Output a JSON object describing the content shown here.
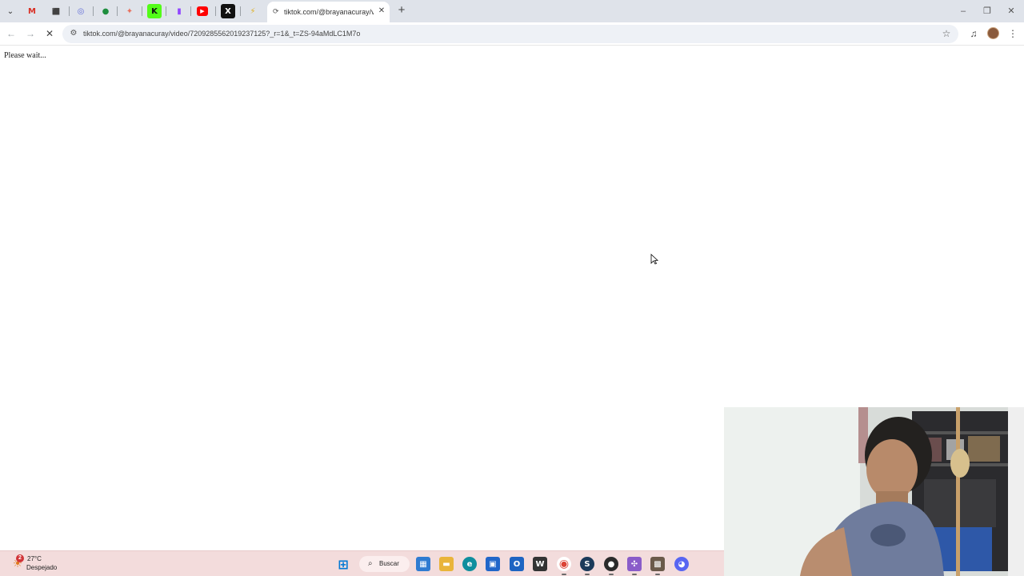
{
  "browser": {
    "active_tab": {
      "title": "tiktok.com/@brayanacuray/vid",
      "close_symbol": "✕"
    },
    "pinned_tabs": [
      {
        "name": "gmail",
        "glyph": "M",
        "color": "#d93025"
      },
      {
        "name": "extension",
        "glyph": "⬛",
        "color": "#3c4043"
      },
      {
        "name": "circle-app",
        "glyph": "◎",
        "color": "#5f6bd8"
      },
      {
        "name": "green-app",
        "glyph": "●",
        "color": "#1e8e3e"
      },
      {
        "name": "butterfly-app",
        "glyph": "✦",
        "color": "#e8715f"
      },
      {
        "name": "kick",
        "glyph": "K",
        "color": "#1a1a1a"
      },
      {
        "name": "twitch",
        "glyph": "▮",
        "color": "#9146ff"
      },
      {
        "name": "youtube",
        "glyph": "▶",
        "color": "#ff0000"
      },
      {
        "name": "x",
        "glyph": "X",
        "color": "#111111"
      },
      {
        "name": "yellow-app",
        "glyph": "⚡",
        "color": "#e0b020"
      }
    ],
    "url": "tiktok.com/@brayanacuray/video/7209285562019237125?_r=1&_t=ZS-94aMdLC1M7o",
    "reload_state": "loading"
  },
  "page": {
    "message": "Please wait..."
  },
  "taskbar": {
    "weather": {
      "temp": "27°C",
      "condition": "Despejado",
      "badge": "2"
    },
    "search_label": "Buscar",
    "apps": [
      {
        "name": "windows-start",
        "glyph": "⊞",
        "color": "#0078d4"
      },
      {
        "name": "widgets",
        "glyph": "▦",
        "color": "#2f7bd1"
      },
      {
        "name": "file-explorer",
        "glyph": "▬",
        "color": "#e9b43a"
      },
      {
        "name": "edge",
        "glyph": "e",
        "color": "#0f8e9e"
      },
      {
        "name": "store",
        "glyph": "▣",
        "color": "#2166c9"
      },
      {
        "name": "outlook",
        "glyph": "O",
        "color": "#1d64c2"
      },
      {
        "name": "app-v",
        "glyph": "W",
        "color": "#333333"
      },
      {
        "name": "chrome",
        "glyph": "◉",
        "color": "#34a853"
      },
      {
        "name": "steam",
        "glyph": "S",
        "color": "#1b3a5a"
      },
      {
        "name": "obs",
        "glyph": "●",
        "color": "#2b2b2b"
      },
      {
        "name": "app-purple",
        "glyph": "✣",
        "color": "#8a5cc9"
      },
      {
        "name": "app-image",
        "glyph": "▩",
        "color": "#6b5a4a"
      },
      {
        "name": "discord",
        "glyph": "◕",
        "color": "#5865f2"
      }
    ]
  }
}
